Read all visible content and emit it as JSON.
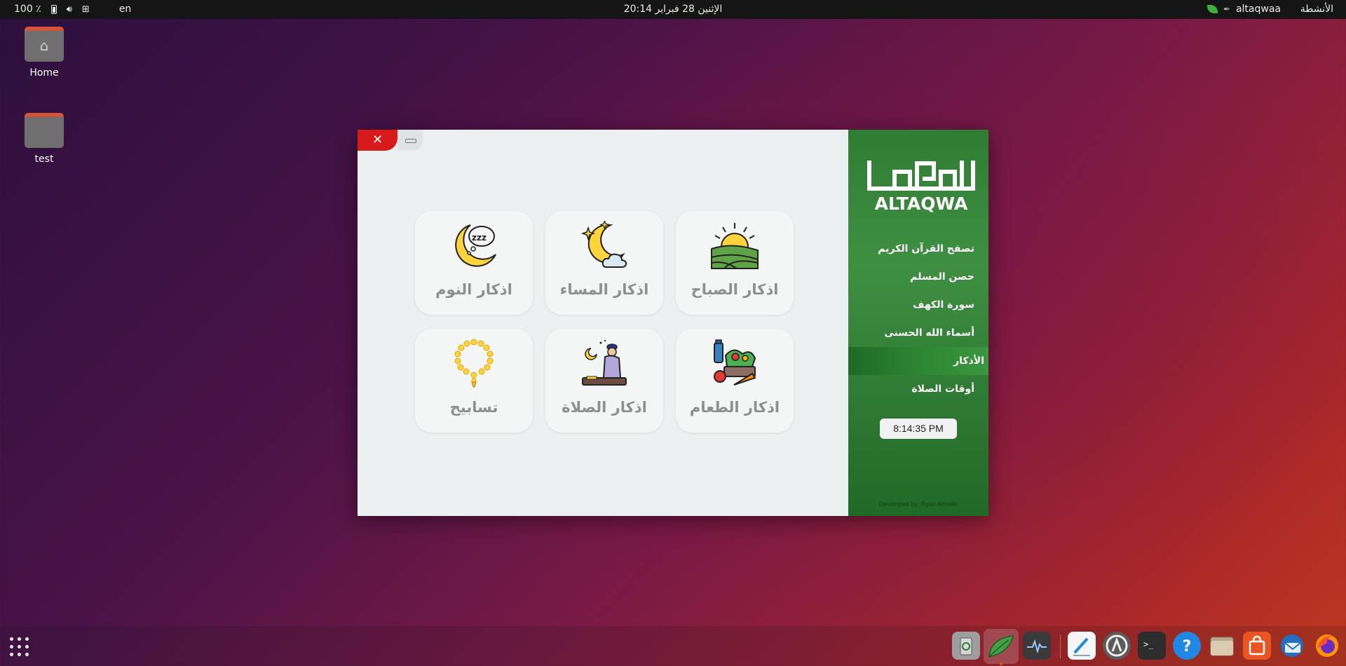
{
  "topbar": {
    "activities": "الأنشطة",
    "app_name": "altaqwaa",
    "clock": "الإثنين 28 فبراير 20:14",
    "battery": "100 ٪",
    "lang": "en"
  },
  "desktop": {
    "icons": [
      {
        "label": "Home",
        "icon": "home-icon"
      },
      {
        "label": "test",
        "icon": "folder-icon"
      }
    ]
  },
  "window": {
    "close_symbol": "✕",
    "cards": [
      {
        "label": "اذكار الصباح",
        "icon": "sunrise-icon"
      },
      {
        "label": "اذكار المساء",
        "icon": "moon-cloud-icon"
      },
      {
        "label": "اذكار النوم",
        "icon": "sleep-moon-icon"
      },
      {
        "label": "اذكار الطعام",
        "icon": "food-basket-icon"
      },
      {
        "label": "اذكار الصلاة",
        "icon": "prayer-icon"
      },
      {
        "label": "تسابيح",
        "icon": "prayer-beads-icon"
      }
    ],
    "sidebar": {
      "logo_text": "ALTAQWA",
      "menu": [
        {
          "label": "تصفح القرآن الكريم"
        },
        {
          "label": "حصن المسلم"
        },
        {
          "label": "سورة الكهف"
        },
        {
          "label": "أسماء الله الحسنى"
        },
        {
          "label": "الأذكار",
          "active": true
        },
        {
          "label": "أوقات الصلاة"
        }
      ],
      "time": "8:14:35 PM",
      "credit": "Developed by: Ryan Almalki"
    }
  },
  "colors": {
    "sidebar_green": "#2f7d34",
    "close_red": "#d91a1a",
    "card_bg": "#f4f5f5",
    "window_bg": "#ecf0f1"
  },
  "dock": {
    "apps": [
      "trash-icon",
      "altaqwaa-icon",
      "system-monitor-icon",
      "text-editor-icon",
      "software-updater-icon",
      "terminal-icon",
      "help-icon",
      "files-icon",
      "app-store-icon",
      "thunderbird-icon",
      "firefox-icon"
    ]
  }
}
